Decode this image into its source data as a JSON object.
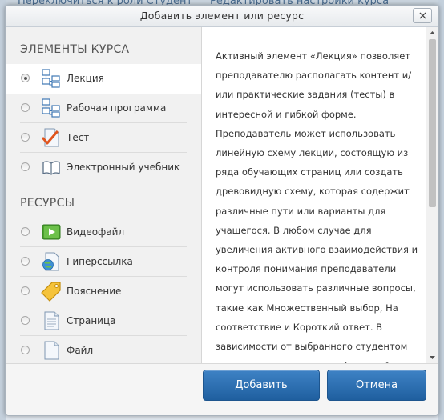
{
  "background": {
    "visible_text_left": "Переключиться к роли Студент",
    "visible_text_right": "Редактировать настройки курса"
  },
  "modal": {
    "title": "Добавить элемент или ресурс",
    "close_icon": "close-icon"
  },
  "sections": {
    "activities_title": "ЭЛЕМЕНТЫ КУРСА",
    "resources_title": "РЕСУРСЫ"
  },
  "activities": [
    {
      "label": "Лекция",
      "icon": "lesson-icon",
      "selected": true
    },
    {
      "label": "Рабочая программа",
      "icon": "workplan-icon",
      "selected": false
    },
    {
      "label": "Тест",
      "icon": "quiz-icon",
      "selected": false
    },
    {
      "label": "Электронный учебник",
      "icon": "book-icon",
      "selected": false
    }
  ],
  "resources": [
    {
      "label": "Видеофайл",
      "icon": "video-icon",
      "selected": false
    },
    {
      "label": "Гиперссылка",
      "icon": "url-icon",
      "selected": false
    },
    {
      "label": "Пояснение",
      "icon": "label-icon",
      "selected": false
    },
    {
      "label": "Страница",
      "icon": "page-icon",
      "selected": false
    },
    {
      "label": "Файл",
      "icon": "file-icon",
      "selected": false
    }
  ],
  "description": {
    "text": "Активный элемент «Лекция» позволяет преподавателю располагать контент и/или практические задания (тесты) в интересной и гибкой форме. Преподаватель может использовать линейную схему лекции, состоящую из ряда обучающих страниц или создать древовидную схему, которая содержит различные пути или варианты для учащегося. В любом случае для увеличения активного взаимодействия и контроля понимания преподаватели могут использовать различные вопросы, такие как Множественный выбор, На соответствие и Короткий ответ. В зависимости от выбранного студентом ответа и стратегии, разработанной преподавателем, студенты могут перейти"
  },
  "footer": {
    "add_label": "Добавить",
    "cancel_label": "Отмена"
  },
  "colors": {
    "primary_button": "#2a6fb3",
    "list_background": "#f1f1f1",
    "selected_background": "#ffffff"
  }
}
